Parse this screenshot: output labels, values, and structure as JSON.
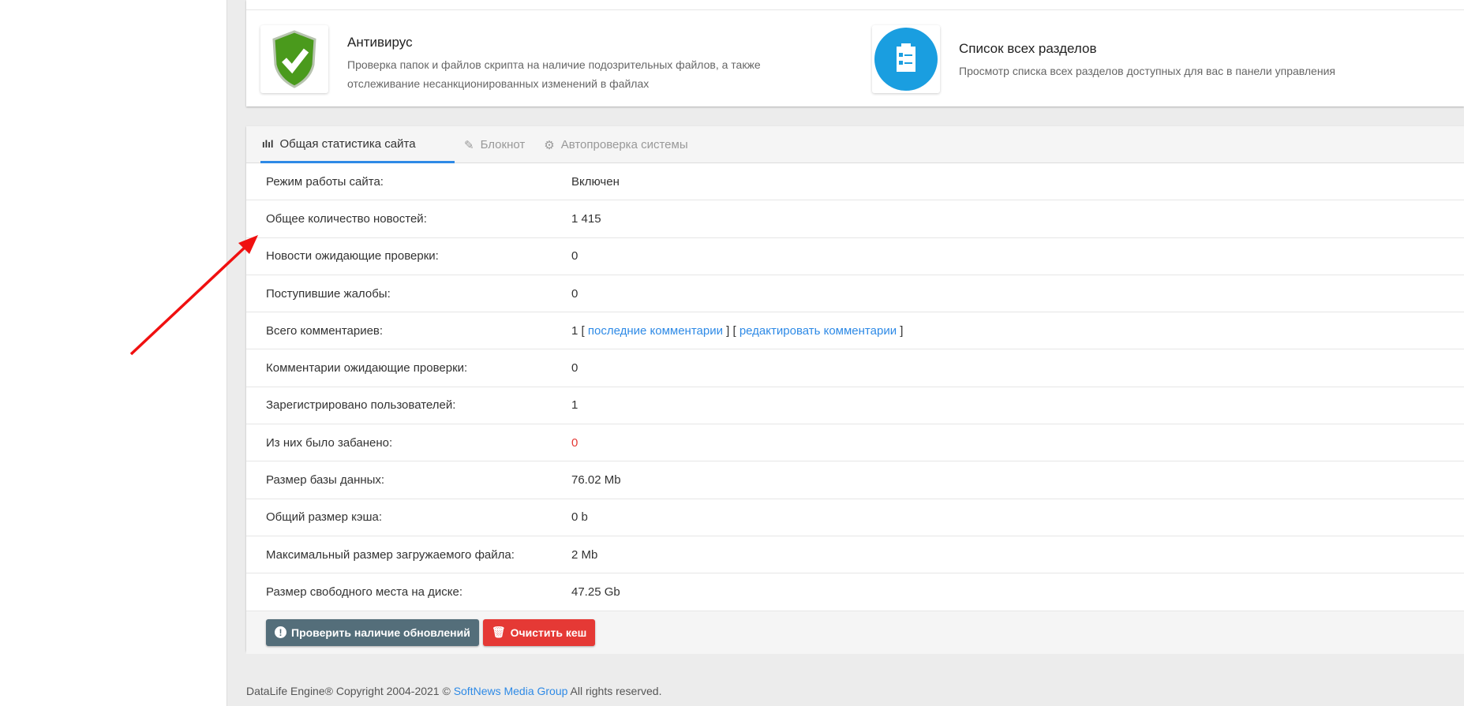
{
  "tiles": [
    {
      "title": "Антивирус",
      "desc": "Проверка папок и файлов скрипта на наличие подозрительных файлов, а также отслеживание несанкционированных изменений в файлах",
      "icon": "shield-check-icon"
    },
    {
      "title": "Список всех разделов",
      "desc": "Просмотр списка всех разделов доступных для вас в панели управления",
      "icon": "clipboard-list-icon"
    }
  ],
  "tabs": [
    "Общая статистика сайта",
    "Блокнот",
    "Автопроверка системы"
  ],
  "stats": [
    {
      "label": "Режим работы сайта:",
      "value": "Включен"
    },
    {
      "label": "Общее количество новостей:",
      "value": "1 415"
    },
    {
      "label": "Новости ожидающие проверки:",
      "value": "0"
    },
    {
      "label": "Поступившие жалобы:",
      "value": "0"
    },
    {
      "label": "Всего комментариев:",
      "value": "1",
      "pre1": " [ ",
      "link1": "последние комментарии",
      "mid": " ] [ ",
      "link2": "редактировать комментарии",
      "post": " ]"
    },
    {
      "label": "Комментарии ожидающие проверки:",
      "value": "0"
    },
    {
      "label": "Зарегистрировано пользователей:",
      "value": "1"
    },
    {
      "label": "Из них было забанено:",
      "value": "0"
    },
    {
      "label": "Размер базы данных:",
      "value": "76.02 Mb"
    },
    {
      "label": "Общий размер кэша:",
      "value": "0 b"
    },
    {
      "label": "Максимальный размер загружаемого файла:",
      "value": "2 Mb"
    },
    {
      "label": "Размер свободного места на диске:",
      "value": "47.25 Gb"
    }
  ],
  "buttons": {
    "check_updates": "Проверить наличие обновлений",
    "clear_cache": "Очистить кеш"
  },
  "colors": {
    "accent": "#2e8ae6",
    "danger": "#e53935",
    "dark_button": "#546e7a"
  },
  "footer": {
    "pre": "DataLife Engine® Copyright 2004-2021 © ",
    "link": "SoftNews Media Group",
    "post": " All rights reserved."
  }
}
